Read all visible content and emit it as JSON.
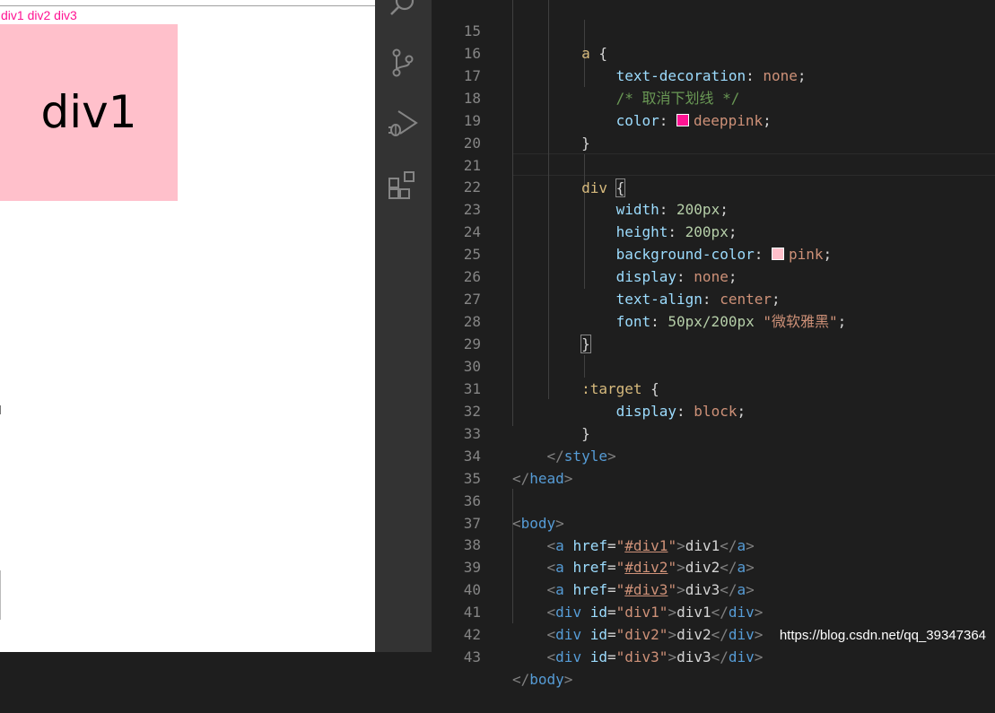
{
  "browser": {
    "links": [
      "div1",
      "div2",
      "div3"
    ],
    "box_text": "div1",
    "link_color": "#ff1493",
    "box_color": "#ffc0cb"
  },
  "activity_bar": {
    "icons": [
      "search-icon",
      "source-control-icon",
      "run-debug-icon",
      "extensions-icon"
    ]
  },
  "editor": {
    "lines": [
      {
        "n": "15"
      },
      {
        "n": "16"
      },
      {
        "n": "17"
      },
      {
        "n": "18"
      },
      {
        "n": "19"
      },
      {
        "n": "20"
      },
      {
        "n": "21"
      },
      {
        "n": "22"
      },
      {
        "n": "23"
      },
      {
        "n": "24"
      },
      {
        "n": "25"
      },
      {
        "n": "26"
      },
      {
        "n": "27"
      },
      {
        "n": "28"
      },
      {
        "n": "29"
      },
      {
        "n": "30"
      },
      {
        "n": "31"
      },
      {
        "n": "32"
      },
      {
        "n": "33"
      },
      {
        "n": "34"
      },
      {
        "n": "35"
      },
      {
        "n": "36"
      },
      {
        "n": "37"
      },
      {
        "n": "38"
      },
      {
        "n": "39"
      },
      {
        "n": "40"
      },
      {
        "n": "41"
      },
      {
        "n": "42"
      },
      {
        "n": "43"
      }
    ],
    "text": {
      "l15_sel": "a",
      "l15_brace": " {",
      "l16_prop": "text-decoration",
      "l16_val": "none",
      "l17_cmt": "/* 取消下划线 */",
      "l18_prop": "color",
      "l18_val": "deeppink",
      "l19_brace": "}",
      "l21_sel": "div",
      "l21_brace": "{",
      "l22_prop": "width",
      "l22_val": "200px",
      "l23_prop": "height",
      "l23_val": "200px",
      "l24_prop": "background-color",
      "l24_val": "pink",
      "l25_prop": "display",
      "l25_val": "none",
      "l26_prop": "text-align",
      "l26_val": "center",
      "l27_prop": "font",
      "l27_num": "50px/200px",
      "l27_str": "\"微软雅黑\"",
      "l28_brace": "}",
      "l30_sel": ":target",
      "l30_brace": " {",
      "l31_prop": "display",
      "l31_val": "block",
      "l32_brace": "}",
      "l33_tag": "style",
      "l34_tag": "head",
      "l36_tag": "body",
      "a_tag": "a",
      "href_attr": "href",
      "l37_href": "#div1",
      "l37_txt": "div1",
      "l38_href": "#div2",
      "l38_txt": "div2",
      "l39_href": "#div3",
      "l39_txt": "div3",
      "div_tag": "div",
      "id_attr": "id",
      "l40_id": "div1",
      "l40_txt": "div1",
      "l41_id": "div2",
      "l41_txt": "div2",
      "l42_id": "div3",
      "l42_txt": "div3",
      "l43_tag": "body"
    },
    "swatches": {
      "deeppink": "#ff1493",
      "pink": "#ffc0cb"
    }
  },
  "watermark": "https://blog.csdn.net/qq_39347364"
}
